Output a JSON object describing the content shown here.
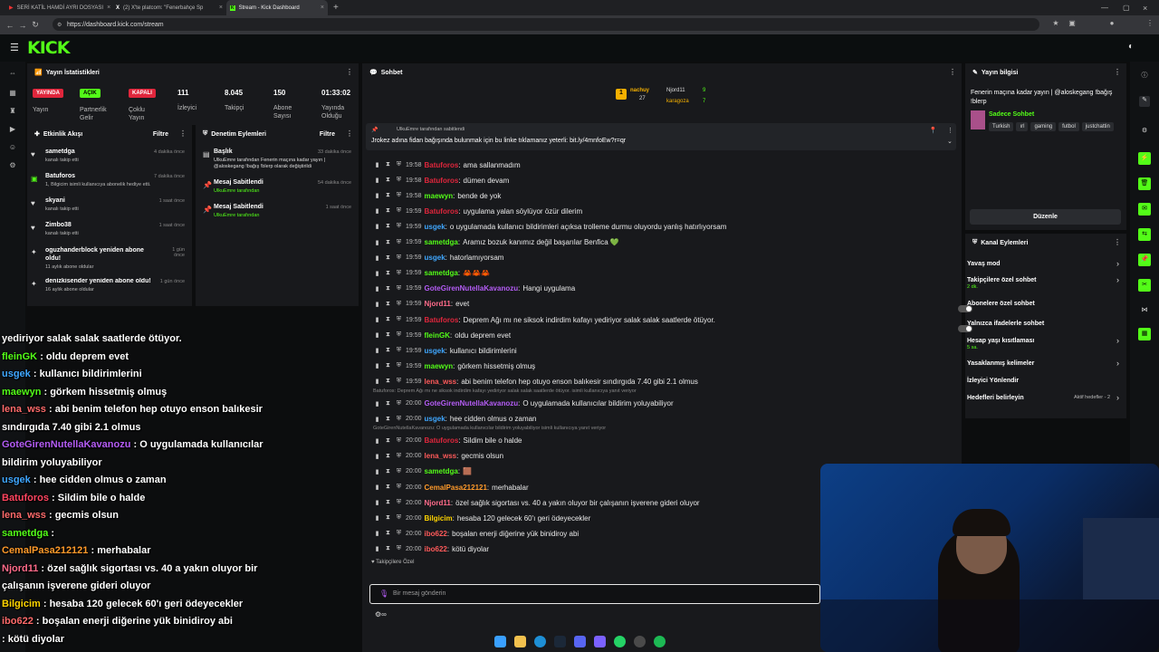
{
  "browser": {
    "tabs": [
      {
        "title": "SERİ KATİL HAMDİ AYRI DOSYASI"
      },
      {
        "title": "(2) X'te platcom: \"Fenerbahçe Sp"
      },
      {
        "title": "Stream - Kick Dashboard"
      }
    ],
    "url": "https://dashboard.kick.com/stream"
  },
  "header": {
    "logo": "KICK"
  },
  "stats": {
    "title": "Yayın İstatistikleri",
    "items": [
      {
        "badge": "YAYINDA",
        "label": "Yayın",
        "color": "#e0263c"
      },
      {
        "badge": "AÇIK",
        "label": "Partnerlik Gelir",
        "color": "#53fc18"
      },
      {
        "badge": "KAPALI",
        "label": "Çoklu Yayın",
        "color": "#e0263c"
      },
      {
        "value": "111",
        "label": "İzleyici"
      },
      {
        "value": "8.045",
        "label": "Takipçi"
      },
      {
        "value": "150",
        "label": "Abone Sayısı"
      },
      {
        "value": "01:33:02",
        "label": "Yayında Olduğu"
      }
    ]
  },
  "activity": {
    "title": "Etkinlik Akışı",
    "filter": "Filtre",
    "events": [
      {
        "name": "sametdga",
        "sub": "kanalı takip etti",
        "time": "4 dakika önce"
      },
      {
        "name": "Batuforos",
        "sub": "1, Bilgicim isimli kullanıcıya abonelik hediye etti.",
        "time": "7 dakika önce"
      },
      {
        "name": "skyani",
        "sub": "kanalı takip etti",
        "time": "1 saat önce"
      },
      {
        "name": "Zimbo38",
        "sub": "kanalı takip etti",
        "time": "1 saat önce"
      },
      {
        "name": "oguzhanderblock yeniden abone oldu!",
        "sub": "11 aylık abone oldular",
        "time": "1 gün önce"
      },
      {
        "name": "denizkisender yeniden abone oldu!",
        "sub": "16 aylık abone oldular",
        "time": "1 gün önce"
      }
    ]
  },
  "moderation": {
    "title": "Denetim Eylemleri",
    "filter": "Filtre",
    "items": [
      {
        "title": "Başlık",
        "sub": "UlkuEmre tarafından Fenerin maçına kadar yayın | @aloskegang !bağış !blerp olarak değiştirildi",
        "time": "33 dakika önce"
      },
      {
        "title": "Mesaj Sabitlendi",
        "sub": "UlkuEmre tarafından",
        "time": "54 dakika önce"
      },
      {
        "title": "Mesaj Sabitlendi",
        "sub": "UlkuEmre tarafından",
        "time": "1 saat önce"
      }
    ]
  },
  "chat": {
    "title": "Sohbet",
    "top_users": [
      {
        "name": "nachuy",
        "count": "27"
      },
      {
        "name": "Njord11",
        "count": "9"
      },
      {
        "name": "karagoza",
        "count": "7"
      }
    ],
    "pinned_by": "UlkuEmre tarafından sabitlendi",
    "pinned_text": "Jrokez adına fidan bağışında bulunmak için bu linke tıklamanız yeterli: bit.ly/4mnfoEw?r=qr",
    "messages": [
      {
        "time": "19:58",
        "user": "Batuforos",
        "color": "#e0263c",
        "text": "ama sallanmadım"
      },
      {
        "time": "19:58",
        "user": "Batuforos",
        "color": "#e0263c",
        "text": "dümen devam"
      },
      {
        "time": "19:58",
        "user": "maewyn",
        "color": "#53fc18",
        "text": "bende de yok"
      },
      {
        "time": "19:59",
        "user": "Batuforos",
        "color": "#e0263c",
        "text": "uygulama yalan söylüyor özür dilerim"
      },
      {
        "time": "19:59",
        "user": "usgek",
        "color": "#3fa7ff",
        "text": "o uygulamada kullanıcı bildirimleri açıksa trolleme durmu oluyordu yanlış hatırlıyorsam"
      },
      {
        "time": "19:59",
        "user": "sametdga",
        "color": "#53fc18",
        "text": "Aramız bozuk kanımız değil başarılar Benfica 💚"
      },
      {
        "time": "19:59",
        "user": "usgek",
        "color": "#3fa7ff",
        "text": "hatorlamıyorsam"
      },
      {
        "time": "19:59",
        "user": "sametdga",
        "color": "#53fc18",
        "text": "🦀🦀🦀"
      },
      {
        "time": "19:59",
        "user": "GoteGirenNutellaKavanozu",
        "color": "#b45cf5",
        "text": "Hangi uygulama"
      },
      {
        "time": "19:59",
        "user": "Njord11",
        "color": "#ff6b8a",
        "text": "evet"
      },
      {
        "time": "19:59",
        "user": "Batuforos",
        "color": "#e0263c",
        "text": "Deprem Ağı mı ne siksok indirdim kafayı yediriyor salak salak saatlerde ötüyor."
      },
      {
        "time": "19:59",
        "user": "fleinGK",
        "color": "#53fc18",
        "text": "oldu deprem evet"
      },
      {
        "time": "19:59",
        "user": "usgek",
        "color": "#3fa7ff",
        "text": "kullanıcı bildirimlerini"
      },
      {
        "time": "19:59",
        "user": "maewyn",
        "color": "#53fc18",
        "text": "görkem hissetmiş olmuş"
      },
      {
        "time": "19:59",
        "user": "lena_wss",
        "color": "#ff5a5a",
        "text": "abi benim telefon hep otuyo enson balıkesir sındırgıda 7.40 gibi 2.1 olmus"
      },
      {
        "reply": "Batuforos: Deprem Ağı mı ne siksok indirdim kafayı yediriyor salak salak saatlerde ötüyor. isimli kullanıcıya yanıt veriyor",
        "time": "20:00",
        "user": "GoteGirenNutellaKavanozu",
        "color": "#b45cf5",
        "text": "O uygulamada kullanıcılar bildirim yoluyabiliyor"
      },
      {
        "time": "20:00",
        "user": "usgek",
        "color": "#3fa7ff",
        "text": "hee cidden olmus o zaman"
      },
      {
        "reply": "GoteGirenNutellaKavanozu: O uygulamada kullanıcılar bildirim yoluyabiliyor isimli kullanıcıya yanıt veriyor",
        "time": "20:00",
        "user": "Batuforos",
        "color": "#e0263c",
        "text": "Sildim bile o halde"
      },
      {
        "time": "20:00",
        "user": "lena_wss",
        "color": "#ff5a5a",
        "text": "gecmis olsun"
      },
      {
        "time": "20:00",
        "user": "sametdga",
        "color": "#53fc18",
        "text": "🟫"
      },
      {
        "time": "20:00",
        "user": "CemalPasa212121",
        "color": "#ff9a2a",
        "text": "merhabalar"
      },
      {
        "time": "20:00",
        "user": "Njord11",
        "color": "#ff6b8a",
        "text": "özel sağlık sigortası vs. 40 a yakın oluyor bir çalışanın işverene gideri oluyor"
      },
      {
        "time": "20:00",
        "user": "Bilgicim",
        "color": "#ffd400",
        "text": "hesaba 120 gelecek 60'ı geri ödeyecekler"
      },
      {
        "time": "20:00",
        "user": "ibo622",
        "color": "#ff5a5a",
        "text": "boşalan enerji diğerine yük binidiroy abi"
      },
      {
        "time": "20:00",
        "user": "ibo622",
        "color": "#ff5a5a",
        "text": "kötü diyolar"
      }
    ],
    "follower_mode": "Takipçilere Özel",
    "input_placeholder": "Bir mesaj gönderin"
  },
  "stream_info": {
    "title": "Yayın bilgisi",
    "stream_title": "Fenerin maçına kadar yayın | @aloskegang !bağış !blerp",
    "category": "Sadece Sohbet",
    "tags": [
      "Turkish",
      "ırl",
      "gaming",
      "futbol",
      "justchattin"
    ],
    "edit_label": "Düzenle"
  },
  "channel_actions": {
    "title": "Kanal Eylemleri",
    "items": [
      {
        "label": "Yavaş mod",
        "type": "chevron"
      },
      {
        "label": "Takipçilere özel sohbet",
        "sub": "2 dk.",
        "type": "chevron"
      },
      {
        "label": "Abonelere özel sohbet",
        "type": "toggle"
      },
      {
        "label": "Yalnızca ifadelerle sohbet",
        "type": "toggle"
      },
      {
        "label": "Hesap yaşı kısıtlaması",
        "sub": "5 sa.",
        "type": "chevron"
      },
      {
        "label": "Yasaklanmış kelimeler",
        "type": "chevron"
      },
      {
        "label": "İzleyici Yönlendir",
        "type": "none"
      },
      {
        "label": "Hedefleri belirleyin",
        "extra": "Aktif hedefler - 2",
        "type": "chevron"
      }
    ]
  },
  "overlay_chat": [
    {
      "user": "",
      "color": "#fff",
      "text": "yediriyor salak salak saatlerde ötüyor."
    },
    {
      "user": "fleinGK",
      "color": "#53fc18",
      "text": ": oldu deprem evet"
    },
    {
      "user": "usgek",
      "color": "#3fa7ff",
      "text": ": kullanıcı bildirimlerini"
    },
    {
      "user": "maewyn",
      "color": "#53fc18",
      "text": ": görkem hissetmiş olmuş"
    },
    {
      "user": "lena_wss",
      "color": "#ff6b6b",
      "text": ": abi benim telefon hep otuyo enson balıkesir"
    },
    {
      "user": "",
      "color": "#fff",
      "text": "sındırgıda 7.40 gibi 2.1 olmus"
    },
    {
      "user": "GoteGirenNutellaKavanozu",
      "color": "#b45cf5",
      "text": ": O uygulamada kullanıcılar"
    },
    {
      "user": "",
      "color": "#fff",
      "text": "bildirim yoluyabiliyor"
    },
    {
      "user": "usgek",
      "color": "#3fa7ff",
      "text": ": hee cidden olmus o zaman"
    },
    {
      "user": "Batuforos",
      "color": "#ff4560",
      "text": ": Sildim bile o halde"
    },
    {
      "user": "lena_wss",
      "color": "#ff6b6b",
      "text": ": gecmis olsun"
    },
    {
      "user": "sametdga",
      "color": "#53fc18",
      "text": ":"
    },
    {
      "user": "CemalPasa212121",
      "color": "#ff9a2a",
      "text": ": merhabalar"
    },
    {
      "user": "Njord11",
      "color": "#ff6b8a",
      "text": ": özel sağlık sigortası vs. 40 a yakın oluyor bir"
    },
    {
      "user": "",
      "color": "#fff",
      "text": "çalışanın işverene gideri oluyor"
    },
    {
      "user": "Bilgicim",
      "color": "#ffd400",
      "text": ": hesaba 120 gelecek 60'ı geri ödeyecekler"
    },
    {
      "user": "ibo622",
      "color": "#ff6b6b",
      "text": ": boşalan enerji diğerine yük binidiroy abi"
    },
    {
      "user": "",
      "color": "#fff",
      "text": ": kötü diyolar"
    }
  ]
}
